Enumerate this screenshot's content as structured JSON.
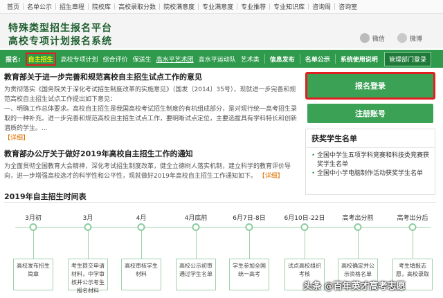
{
  "topnav": [
    "首页",
    "名单公示",
    "招生章程",
    "院校库",
    "高校录取分数",
    "院校满意度",
    "专业满意度",
    "专业推荐",
    "专业知识库",
    "咨询周",
    "咨询室"
  ],
  "brand": {
    "line1": "特殊类型招生报名平台",
    "line2": "高校专项计划报名系统"
  },
  "social": {
    "weixin": "微信",
    "weibo": "微博"
  },
  "mainnav": {
    "label": "报名:",
    "items": [
      "自主招生",
      "高校专项计划",
      "综合评价",
      "保送生",
      "高水平艺术团",
      "高水平运动队",
      "艺术类"
    ],
    "info": [
      "信息发布",
      "名单公示",
      "系统使用说明"
    ],
    "admin": "管理部门登录"
  },
  "news": [
    {
      "title": "教育部关于进一步完善和规范高校自主招生试点工作的意见",
      "p1": "为贯彻落实《国务院关于深化考试招生制度改革的实施意见》（国发〔2014〕35号），现就进一步完善和规范高校自主招生试点工作提出如下意见：",
      "p2": "一、明确工作总体要求。高校自主招生是我国高校考试招生制度的有机组成部分，是对现行统一高考招生录取的一种补充。进一步完善和规范高校自主招生试点工作，要明晰试点定位，主要选拔具有学科特长和创新潜质的学生。...",
      "more": "【详细】"
    },
    {
      "title": "教育部办公厅关于做好2019年高校自主招生工作的通知",
      "p1": "为全面贯彻全国教育大会精神，深化考试招生制度改革，健全立德树人落实机制，建立科学的教育评价导向，进一步增强高校选才的科学性和公平性，现就做好2019年高校自主招生工作通知如下。",
      "more": "【详细】"
    }
  ],
  "buttons": {
    "login": "报名登录",
    "register": "注册账号"
  },
  "winners": {
    "title": "获奖学生名单",
    "items": [
      "全国中学生五项学科竞赛和科技类竞赛获奖学生名单",
      "全国中小学电脑制作活动获奖学生名单"
    ]
  },
  "timeline": {
    "title": "2019年自主招生时间表",
    "steps": [
      {
        "date": "3月初",
        "desc": "高校发布招生简章"
      },
      {
        "date": "3月",
        "desc": "考生提交申请材料，中学审核并公示考生报名材料"
      },
      {
        "date": "4月",
        "desc": "高校审核学生材料"
      },
      {
        "date": "4月底前",
        "desc": "高校公示初审通过学生名单"
      },
      {
        "date": "6月7日-8日",
        "desc": "学生参加全国统一高考"
      },
      {
        "date": "6月10日-22日",
        "desc": "试点高校组织考核"
      },
      {
        "date": "高考出分前",
        "desc": "高校确定并公示资格名单"
      },
      {
        "date": "高考出分后",
        "desc": "考生填报志愿，高校录取"
      }
    ]
  },
  "watermark": "头条 @百年英才高考志愿",
  "colors": {
    "green": "#2f9a4c",
    "button": "#3aa155",
    "highlight": "#e02020",
    "brand": "#1e5e2e"
  }
}
